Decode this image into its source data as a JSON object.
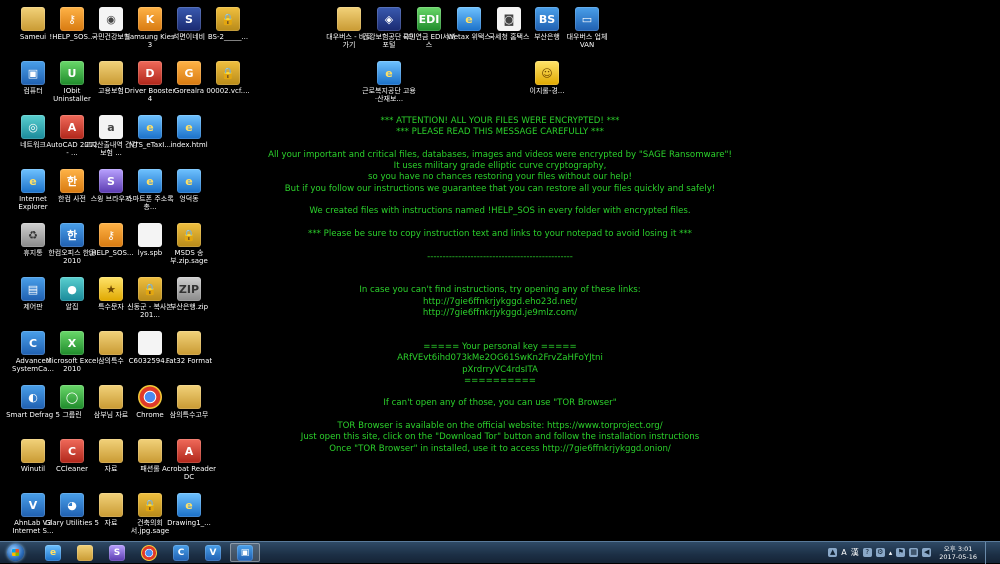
{
  "desktop": {
    "icons": [
      {
        "label": "Sameui",
        "icon": "folder-icon",
        "glyph": "",
        "cls": "g-folder"
      },
      {
        "label": "!HELP_SOS...",
        "icon": "help-sos-file-icon",
        "glyph": "⚷",
        "cls": "g-orange"
      },
      {
        "label": "국민건강보험",
        "icon": "document-icon",
        "glyph": "◉",
        "cls": "g-doc"
      },
      {
        "label": "Samsung Kies 3",
        "icon": "samsung-kies-icon",
        "glyph": "K",
        "cls": "g-orange"
      },
      {
        "label": "석면이네비",
        "icon": "app-icon",
        "glyph": "S",
        "cls": "g-navy"
      },
      {
        "label": "BS-2_____...",
        "icon": "locked-file-icon",
        "glyph": "🔒",
        "cls": "g-lock"
      },
      {
        "label": "컴퓨터",
        "icon": "computer-icon",
        "glyph": "▣",
        "cls": "g-blue"
      },
      {
        "label": "IObit Uninstaller",
        "icon": "iobit-uninstaller-icon",
        "glyph": "U",
        "cls": "g-green"
      },
      {
        "label": "고용보험",
        "icon": "folder-icon",
        "glyph": "",
        "cls": "g-folder"
      },
      {
        "label": "Driver Booster 4",
        "icon": "driver-booster-icon",
        "glyph": "D",
        "cls": "g-red"
      },
      {
        "label": "Gorealra",
        "icon": "gorealra-icon",
        "glyph": "G",
        "cls": "g-orange"
      },
      {
        "label": "00002.vcf....",
        "icon": "locked-file-icon",
        "glyph": "🔒",
        "cls": "g-lock"
      },
      {
        "label": "네트워크",
        "icon": "network-icon",
        "glyph": "◎",
        "cls": "g-teal"
      },
      {
        "label": "AutoCAD 2012 - ...",
        "icon": "autocad-icon",
        "glyph": "A",
        "cls": "g-red"
      },
      {
        "label": "고지산출내역 건강보험 ...",
        "icon": "document-icon",
        "glyph": "a",
        "cls": "g-doc"
      },
      {
        "label": "NTS_eTaxI...",
        "icon": "ie-shortcut-icon",
        "glyph": "e",
        "cls": "g-ie"
      },
      {
        "label": "index.html",
        "icon": "ie-shortcut-icon",
        "glyph": "e",
        "cls": "g-ie"
      },
      {
        "label": "Internet Explorer",
        "icon": "internet-explorer-icon",
        "glyph": "e",
        "cls": "g-ie"
      },
      {
        "label": "한컴 사전",
        "icon": "dictionary-icon",
        "glyph": "한",
        "cls": "g-orange"
      },
      {
        "label": "스윙 브라우저",
        "icon": "swing-browser-icon",
        "glyph": "S",
        "cls": "g-purple"
      },
      {
        "label": "스마트폰 주소록 총...",
        "icon": "ie-shortcut-icon",
        "glyph": "e",
        "cls": "g-ie"
      },
      {
        "label": "엉덕동",
        "icon": "ie-shortcut-icon",
        "glyph": "e",
        "cls": "g-ie"
      },
      {
        "label": "휴지통",
        "icon": "recycle-bin-icon",
        "glyph": "♻",
        "cls": "g-gray"
      },
      {
        "label": "한컴오피스 한글 2010",
        "icon": "hancom-icon",
        "glyph": "한",
        "cls": "g-blue"
      },
      {
        "label": "!HELP_SOS...",
        "icon": "help-sos-file-icon",
        "glyph": "⚷",
        "cls": "g-orange"
      },
      {
        "label": "lys.spb",
        "icon": "document-icon",
        "glyph": "",
        "cls": "g-doc"
      },
      {
        "label": "MSDS 송부.zip.sage",
        "icon": "locked-file-icon",
        "glyph": "🔒",
        "cls": "g-lock"
      },
      {
        "label": "제어판",
        "icon": "control-panel-icon",
        "glyph": "▤",
        "cls": "g-blue"
      },
      {
        "label": "알집",
        "icon": "alzip-icon",
        "glyph": "●",
        "cls": "g-teal"
      },
      {
        "label": "특수문자",
        "icon": "special-char-icon",
        "glyph": "★",
        "cls": "g-yellow"
      },
      {
        "label": "신동군 - 복사본 201...",
        "icon": "locked-file-icon",
        "glyph": "🔒",
        "cls": "g-lock"
      },
      {
        "label": "부산은행.zip",
        "icon": "zip-file-icon",
        "glyph": "ZIP",
        "cls": "g-gray"
      },
      {
        "label": "Advanced SystemCa...",
        "icon": "advanced-systemcare-icon",
        "glyph": "C",
        "cls": "g-blue"
      },
      {
        "label": "Microsoft Excel 2010",
        "icon": "excel-icon",
        "glyph": "X",
        "cls": "g-green"
      },
      {
        "label": "삼의특수",
        "icon": "folder-icon",
        "glyph": "",
        "cls": "g-folder"
      },
      {
        "label": "C6032594...",
        "icon": "document-icon",
        "glyph": "",
        "cls": "g-doc"
      },
      {
        "label": "Fat32 Format",
        "icon": "folder-icon",
        "glyph": "",
        "cls": "g-folder"
      },
      {
        "label": "Smart Defrag 5",
        "icon": "smart-defrag-icon",
        "glyph": "◐",
        "cls": "g-blue"
      },
      {
        "label": "그룹린",
        "icon": "app-icon",
        "glyph": "◯",
        "cls": "g-green"
      },
      {
        "label": "삼부님 자료",
        "icon": "folder-icon",
        "glyph": "",
        "cls": "g-folder"
      },
      {
        "label": "Chrome",
        "icon": "chrome-icon",
        "glyph": "",
        "cls": "g-chrome"
      },
      {
        "label": "삼의특수고무",
        "icon": "folder-icon",
        "glyph": "",
        "cls": "g-folder"
      },
      {
        "label": "Winutil",
        "icon": "folder-icon",
        "glyph": "",
        "cls": "g-folder"
      },
      {
        "label": "CCleaner",
        "icon": "ccleaner-icon",
        "glyph": "C",
        "cls": "g-red"
      },
      {
        "label": "자료",
        "icon": "folder-icon",
        "glyph": "",
        "cls": "g-folder"
      },
      {
        "label": "패션롤",
        "icon": "folder-icon",
        "glyph": "",
        "cls": "g-folder"
      },
      {
        "label": "Acrobat Reader DC",
        "icon": "acrobat-icon",
        "glyph": "A",
        "cls": "g-red"
      },
      {
        "label": "AhnLab V3 Internet S...",
        "icon": "ahnlab-v3-icon",
        "glyph": "V",
        "cls": "g-blue"
      },
      {
        "label": "Glary Utilities 5",
        "icon": "glary-utilities-icon",
        "glyph": "◕",
        "cls": "g-blue"
      },
      {
        "label": "자료",
        "icon": "folder-icon",
        "glyph": "",
        "cls": "g-folder"
      },
      {
        "label": "건축의회서.jpg.sage",
        "icon": "locked-file-icon",
        "glyph": "🔒",
        "cls": "g-lock"
      },
      {
        "label": "Drawing1_...",
        "icon": "ie-shortcut-icon",
        "glyph": "e",
        "cls": "g-ie"
      },
      {
        "label": "대우버스 - 바로 가기",
        "icon": "folder-icon",
        "glyph": "",
        "cls": "g-folder"
      },
      {
        "label": "건강보험공단 EDI포털",
        "icon": "app-icon",
        "glyph": "◈",
        "cls": "g-navy"
      },
      {
        "label": "국민연금 EDI서비스",
        "icon": "edi-icon",
        "glyph": "EDI",
        "cls": "g-green"
      },
      {
        "label": "Wetax 위택스",
        "icon": "ie-shortcut-icon",
        "glyph": "e",
        "cls": "g-ie"
      },
      {
        "label": "국세청 홈택스",
        "icon": "document-icon",
        "glyph": "◙",
        "cls": "g-doc"
      },
      {
        "label": "부산은행",
        "icon": "busan-bank-icon",
        "glyph": "BS",
        "cls": "g-blue"
      },
      {
        "label": "대우버스 업체VAN",
        "icon": "computer-icon",
        "glyph": "▭",
        "cls": "g-blue"
      },
      {
        "label": "근로복지공단 고용·산재보...",
        "icon": "ie-shortcut-icon",
        "glyph": "e",
        "cls": "g-ie"
      },
      {
        "label": "이지롤-경...",
        "icon": "character-icon",
        "glyph": "☺",
        "cls": "g-yellow"
      }
    ]
  },
  "ransom_note": {
    "lines": [
      {
        "text": "*** ATTENTION! ALL YOUR FILES WERE ENCRYPTED! ***"
      },
      {
        "text": "*** PLEASE READ THIS MESSAGE CAREFULLY ***"
      },
      {
        "text": ""
      },
      {
        "text": "All your important and critical files, databases, images and videos were encrypted by \"SAGE Ransomware\"!"
      },
      {
        "text": "It uses military grade elliptic curve cryptography,"
      },
      {
        "text": "so you have no chances restoring your files without our help!"
      },
      {
        "text": "But if you follow our instructions we guarantee that you can restore all your files quickly and safely!"
      },
      {
        "text": ""
      },
      {
        "text": "We created files with instructions named !HELP_SOS in every folder with encrypted files."
      },
      {
        "text": ""
      },
      {
        "text": "*** Please be sure to copy instruction text and links to your notepad to avoid losing it ***"
      },
      {
        "text": ""
      },
      {
        "text": "-----------------------------------------------"
      },
      {
        "text": ""
      },
      {
        "text": ""
      },
      {
        "text": "In case you can't find instructions, try opening any of these links:"
      },
      {
        "text": "http://7gie6ffnkrjykggd.eho23d.net/"
      },
      {
        "text": "http://7gie6ffnkrjykggd.je9mlz.com/"
      },
      {
        "text": ""
      },
      {
        "text": ""
      },
      {
        "text": "===== Your personal key ====="
      },
      {
        "text": "ARfVEvt6ihd073kMe2OG61SwKn2FrvZaHFoYJtni"
      },
      {
        "text": "pXrdrryVC4rdsITA"
      },
      {
        "text": "=========="
      },
      {
        "text": ""
      },
      {
        "text": "If can't open any of those, you can use \"TOR Browser\""
      },
      {
        "text": ""
      },
      {
        "text": "TOR Browser is available on the official website: https://www.torproject.org/"
      },
      {
        "text": "Just open this site, click on the \"Download Tor\" button and follow the installation instructions"
      },
      {
        "text": "Once \"TOR Browser\" in installed, use it to access http://7gie6ffnkrjykggd.onion/"
      }
    ]
  },
  "taskbar": {
    "pinned": [
      {
        "name": "taskbar-internet-explorer",
        "icon": "internet-explorer-icon",
        "glyph": "e",
        "cls": "g-ie"
      },
      {
        "name": "taskbar-file-explorer",
        "icon": "folder-icon",
        "glyph": "",
        "cls": "g-folder"
      },
      {
        "name": "taskbar-swing-browser",
        "icon": "swing-browser-icon",
        "glyph": "S",
        "cls": "g-purple"
      },
      {
        "name": "taskbar-chrome",
        "icon": "chrome-icon",
        "glyph": "",
        "cls": "g-chrome"
      },
      {
        "name": "taskbar-advanced-systemcare",
        "icon": "advanced-systemcare-icon",
        "glyph": "C",
        "cls": "g-blue"
      },
      {
        "name": "taskbar-ahnlab-v3",
        "icon": "ahnlab-v3-icon",
        "glyph": "V",
        "cls": "g-blue"
      },
      {
        "name": "taskbar-remote-desktop",
        "icon": "computer-icon",
        "glyph": "▣",
        "cls": "g-blue"
      }
    ],
    "tray": {
      "language": "A",
      "ime": "漢",
      "clock_time": "오후 3:01",
      "clock_date": "2017-05-16"
    }
  },
  "colors": {
    "desktop_bg": "#000000",
    "note_text": "#2cd22c",
    "taskbar": "#1c2f45"
  }
}
